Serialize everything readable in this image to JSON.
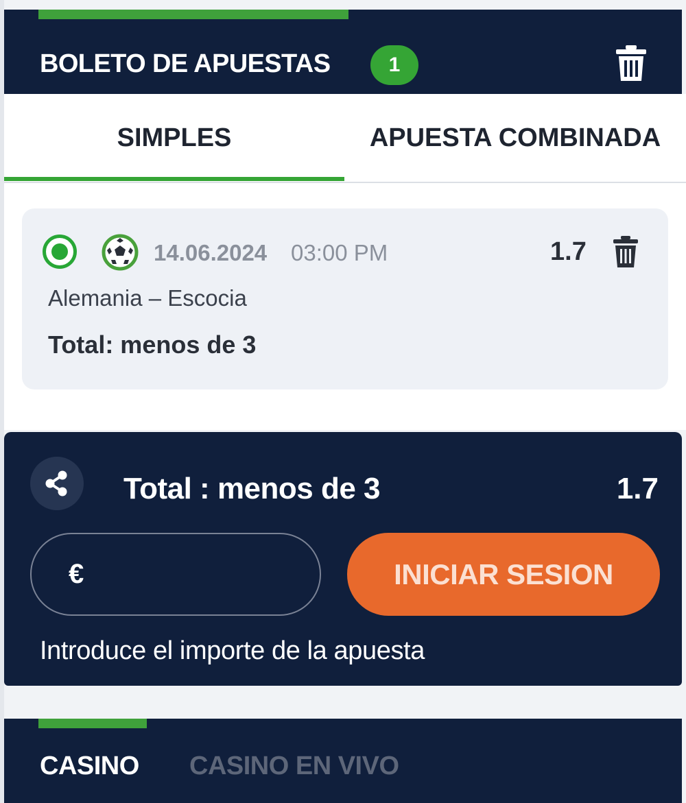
{
  "betslip": {
    "title": "BOLETO DE APUESTAS",
    "count": "1",
    "clear_icon": "trash-icon"
  },
  "tabs": [
    {
      "label": "SIMPLES",
      "active": true
    },
    {
      "label": "APUESTA COMBINADA",
      "active": false
    }
  ],
  "bet": {
    "sport_icon": "soccer-ball-icon",
    "date": "14.06.2024",
    "time": "03:00 PM",
    "odds": "1.7",
    "match": "Alemania – Escocia",
    "market": "Total: menos de 3",
    "selected": true
  },
  "stake": {
    "share_icon": "share-icon",
    "selection": "Total : menos de 3",
    "odds": "1.7",
    "currency": "€",
    "amount_value": "",
    "login_label": "INICIAR SESION",
    "hint": "Introduce el importe de la apuesta"
  },
  "casino": {
    "tabs": [
      {
        "label": "CASINO",
        "active": true
      },
      {
        "label": "CASINO EN VIVO",
        "active": false
      }
    ]
  },
  "colors": {
    "navy": "#101f3c",
    "green": "#35a535",
    "orange": "#e8692c"
  }
}
